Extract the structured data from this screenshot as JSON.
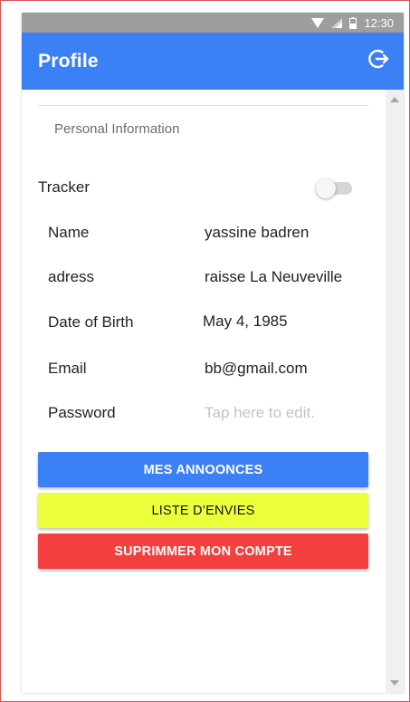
{
  "status_bar": {
    "time": "12:30",
    "icons": [
      "wifi-icon",
      "cell-signal-icon",
      "battery-icon"
    ]
  },
  "app_bar": {
    "title": "Profile",
    "action_icon": "logout-icon"
  },
  "profile": {
    "section_title": "Personal Information",
    "tracker": {
      "label": "Tracker",
      "enabled": false
    },
    "fields": [
      {
        "label": "Name",
        "value": "yassine badren"
      },
      {
        "label": "adress",
        "value": "raisse La Neuveville"
      },
      {
        "label": "Date of Birth",
        "value": "May 4, 1985"
      },
      {
        "label": "Email",
        "value": "bb@gmail.com"
      },
      {
        "label": "Password",
        "placeholder": "Tap here to edit."
      }
    ]
  },
  "buttons": {
    "mes_annonces": "MES ANNOONCES",
    "liste_envies": "LISTE D’ENVIES",
    "supprimer_compte": "SUPRIMMER MON COMPTE"
  },
  "colors": {
    "primary": "#3c80f6",
    "yellow_button": "#ecff3b",
    "danger": "#f53f3f",
    "status_bar": "#9e9e9e"
  }
}
